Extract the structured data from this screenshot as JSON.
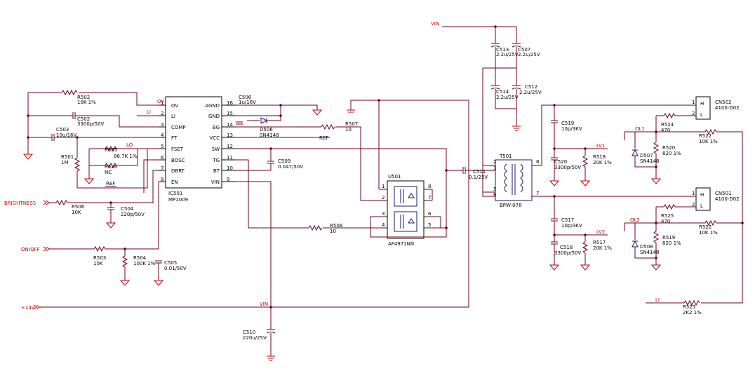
{
  "ic": {
    "ref": "IC501",
    "part": "MP1009",
    "left_pins": [
      {
        "num": "1",
        "name": "OV"
      },
      {
        "num": "2",
        "name": "LI"
      },
      {
        "num": "3",
        "name": "COMP"
      },
      {
        "num": "4",
        "name": "FT"
      },
      {
        "num": "5",
        "name": "FSET"
      },
      {
        "num": "6",
        "name": "BOSC"
      },
      {
        "num": "7",
        "name": "DBRT"
      },
      {
        "num": "8",
        "name": "EN"
      }
    ],
    "right_pins": [
      {
        "num": "16",
        "name": "AGND"
      },
      {
        "num": "15",
        "name": "GND"
      },
      {
        "num": "14",
        "name": "BG"
      },
      {
        "num": "13",
        "name": "VCC"
      },
      {
        "num": "12",
        "name": "SW"
      },
      {
        "num": "11",
        "name": "TG"
      },
      {
        "num": "10",
        "name": "BT"
      },
      {
        "num": "9",
        "name": "VIN"
      }
    ]
  },
  "mosfet": {
    "ref": "U501",
    "part": "AF4971NN",
    "pins": [
      "1",
      "2",
      "3",
      "4",
      "8",
      "7",
      "6",
      "5"
    ]
  },
  "transformer": {
    "ref": "T501",
    "part": "BPW-078",
    "pins": [
      "2",
      "3",
      "5",
      "6",
      "8",
      "7"
    ]
  },
  "nets": {
    "vin": "VIN",
    "v14": "+14V",
    "brightness": "BRIGHTNESS",
    "onoff": "ON/OFF",
    "ov": "OV",
    "li": "LI",
    "lo": "LO",
    "ref": "REF",
    "lv1": "LV1",
    "lv2": "LV2",
    "ol1": "OL1",
    "ol2": "OL2"
  },
  "parts": {
    "r502": {
      "ref": "R502",
      "val": "10K 1%"
    },
    "c502": {
      "ref": "C502",
      "val": "3300p/50V"
    },
    "c503": {
      "ref": "C503",
      "val": "10u/16V"
    },
    "r501": {
      "ref": "R501",
      "val": "1M"
    },
    "r505": {
      "ref": "R505",
      "val": "86.7K 1%"
    },
    "r526": {
      "ref": "R526",
      "val": "NC"
    },
    "r506": {
      "ref": "R506",
      "val": "10K"
    },
    "c504": {
      "ref": "C504",
      "val": "220p/50V"
    },
    "r503": {
      "ref": "R503",
      "val": "10K"
    },
    "r504": {
      "ref": "R504",
      "val": "100K 1%"
    },
    "c505": {
      "ref": "C505",
      "val": "0.01/50V"
    },
    "c506": {
      "ref": "C506",
      "val": "1u/16V"
    },
    "d506": {
      "ref": "D506",
      "val": "SN4148"
    },
    "r507": {
      "ref": "R507",
      "val": "10"
    },
    "c509": {
      "ref": "C509",
      "val": "0.047/50V"
    },
    "r508": {
      "ref": "R508",
      "val": "10"
    },
    "c510": {
      "ref": "C510",
      "val": "220u/25V"
    },
    "c511": {
      "ref": "C511",
      "val": "0.1/25V"
    },
    "c513": {
      "ref": "C513",
      "val": "2.2u/25V"
    },
    "c507": {
      "ref": "C507",
      "val": "2.2u/25V"
    },
    "c514": {
      "ref": "C514",
      "val": "2.2u/25V"
    },
    "c512": {
      "ref": "C512",
      "val": "2.2u/25V"
    },
    "c519": {
      "ref": "C519",
      "val": "10p/3KV"
    },
    "c520": {
      "ref": "C520",
      "val": "3300p/50V"
    },
    "r518": {
      "ref": "R518",
      "val": "20K 1%"
    },
    "c517": {
      "ref": "C517",
      "val": "10p/3KV"
    },
    "c518": {
      "ref": "C518",
      "val": "3300p/50V"
    },
    "r517": {
      "ref": "R517",
      "val": "20K 1%"
    },
    "cn502": {
      "ref": "CN502",
      "val": "4100-D02"
    },
    "cn501": {
      "ref": "CN501",
      "val": "4100-D02"
    },
    "r524": {
      "ref": "R524",
      "val": "470"
    },
    "r520": {
      "ref": "R520",
      "val": "820 1%"
    },
    "d507": {
      "ref": "D507",
      "val": "SN4148"
    },
    "r522a": {
      "ref": "R522",
      "val": "10K 1%"
    },
    "r525": {
      "ref": "R525",
      "val": "470"
    },
    "r519": {
      "ref": "R519",
      "val": "820 1%"
    },
    "d508": {
      "ref": "D508",
      "val": "SN4148"
    },
    "r522b": {
      "ref": "R522",
      "val": "10K 1%"
    },
    "r523": {
      "ref": "R523",
      "val": "2K2 1%"
    }
  },
  "connector_pins": {
    "p1": "1",
    "p2": "2",
    "h": "H",
    "l": "L"
  }
}
